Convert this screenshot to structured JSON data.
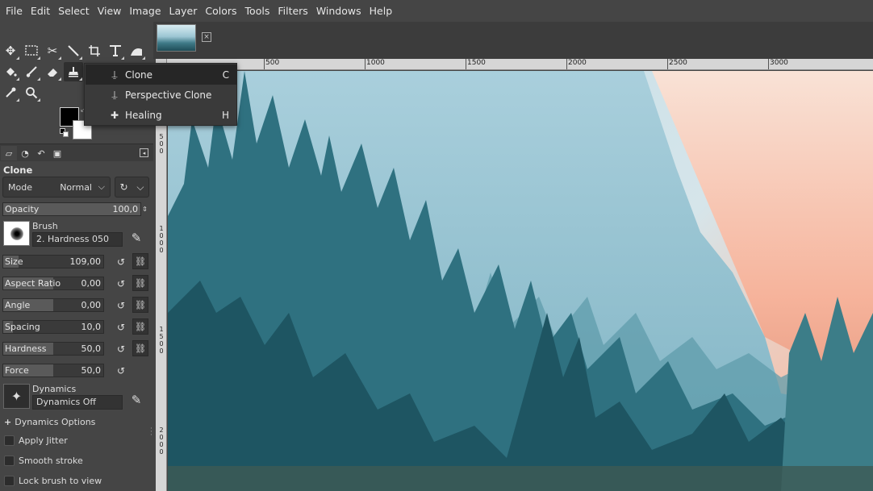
{
  "menu": [
    "File",
    "Edit",
    "Select",
    "View",
    "Image",
    "Layer",
    "Colors",
    "Tools",
    "Filters",
    "Windows",
    "Help"
  ],
  "tool_options": {
    "title": "Clone",
    "mode_label": "Mode",
    "mode_value": "Normal",
    "opacity": {
      "label": "Opacity",
      "value": "100,0",
      "fraction": 1.0
    },
    "brush": {
      "label": "Brush",
      "name": "2. Hardness 050"
    },
    "size": {
      "label": "Size",
      "value": "109,00",
      "fraction": 0.15
    },
    "aspect_ratio": {
      "label": "Aspect Ratio",
      "value": "0,00",
      "fraction": 0.5
    },
    "angle": {
      "label": "Angle",
      "value": "0,00",
      "fraction": 0.5
    },
    "spacing": {
      "label": "Spacing",
      "value": "10,0",
      "fraction": 0.1
    },
    "hardness": {
      "label": "Hardness",
      "value": "50,0",
      "fraction": 0.5
    },
    "force": {
      "label": "Force",
      "value": "50,0",
      "fraction": 0.5
    },
    "dynamics": {
      "label": "Dynamics",
      "name": "Dynamics Off"
    },
    "dynamics_options": "Dynamics Options",
    "apply_jitter": "Apply Jitter",
    "smooth_stroke": "Smooth stroke",
    "lock_brush": "Lock brush to view"
  },
  "tool_popup": {
    "items": [
      {
        "label": "Clone",
        "key": "C",
        "icon": "clone-stamp-icon"
      },
      {
        "label": "Perspective Clone",
        "key": "",
        "icon": "perspective-clone-icon"
      },
      {
        "label": "Healing",
        "key": "H",
        "icon": "healing-icon"
      }
    ]
  },
  "ruler": {
    "top_labels": [
      "500",
      "1000",
      "1500",
      "2000",
      "2500",
      "3000"
    ],
    "left_labels": [
      [
        "5",
        "0",
        "0"
      ],
      [
        "1",
        "0",
        "0",
        "0"
      ],
      [
        "1",
        "5",
        "0",
        "0"
      ],
      [
        "2",
        "0",
        "0",
        "0"
      ]
    ]
  },
  "colors": {
    "foreground": "#000000",
    "background": "#ffffff"
  }
}
